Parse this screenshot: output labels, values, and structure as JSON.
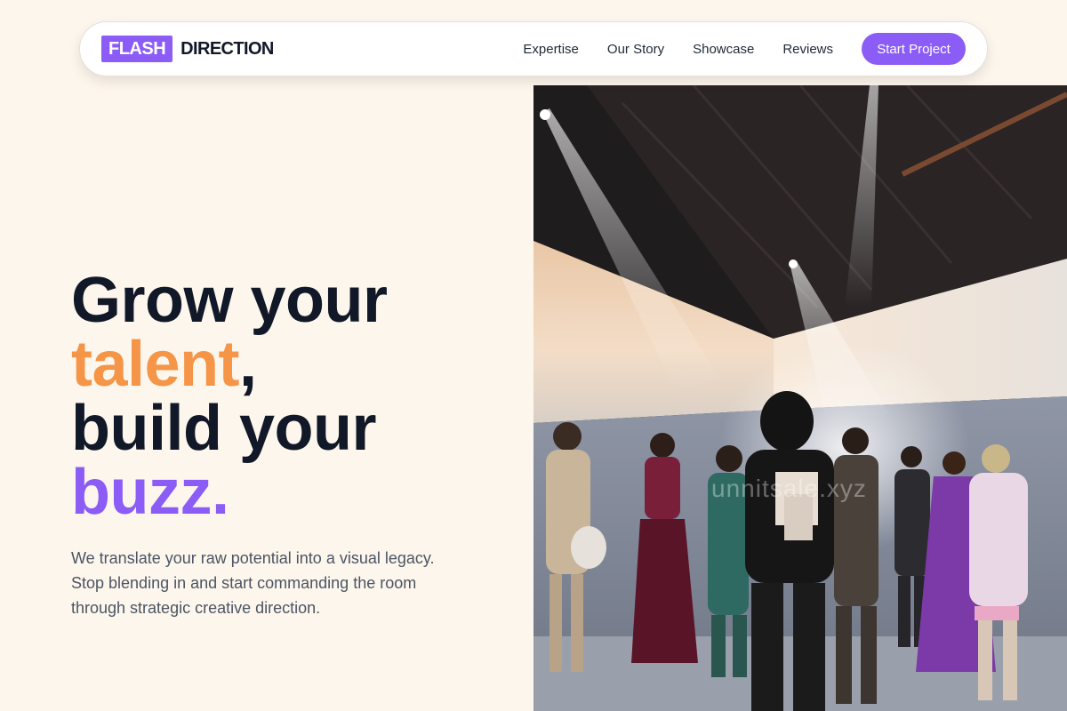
{
  "brand": {
    "logo_mark": "FLASH",
    "logo_text": "DIRECTION",
    "accent_color": "#8b5cf6",
    "highlight_color": "#f59548"
  },
  "nav": {
    "links": [
      "Expertise",
      "Our Story",
      "Showcase",
      "Reviews"
    ],
    "cta_label": "Start Project"
  },
  "hero": {
    "title_line1": "Grow your",
    "title_word_talent": "talent",
    "title_comma": ",",
    "title_line3": "build your",
    "title_word_buzz": "buzz.",
    "subtitle": "We translate your raw potential into a visual legacy. Stop blending in and start commanding the room through strategic creative direction.",
    "image_watermark": "unnitsale.xyz"
  }
}
